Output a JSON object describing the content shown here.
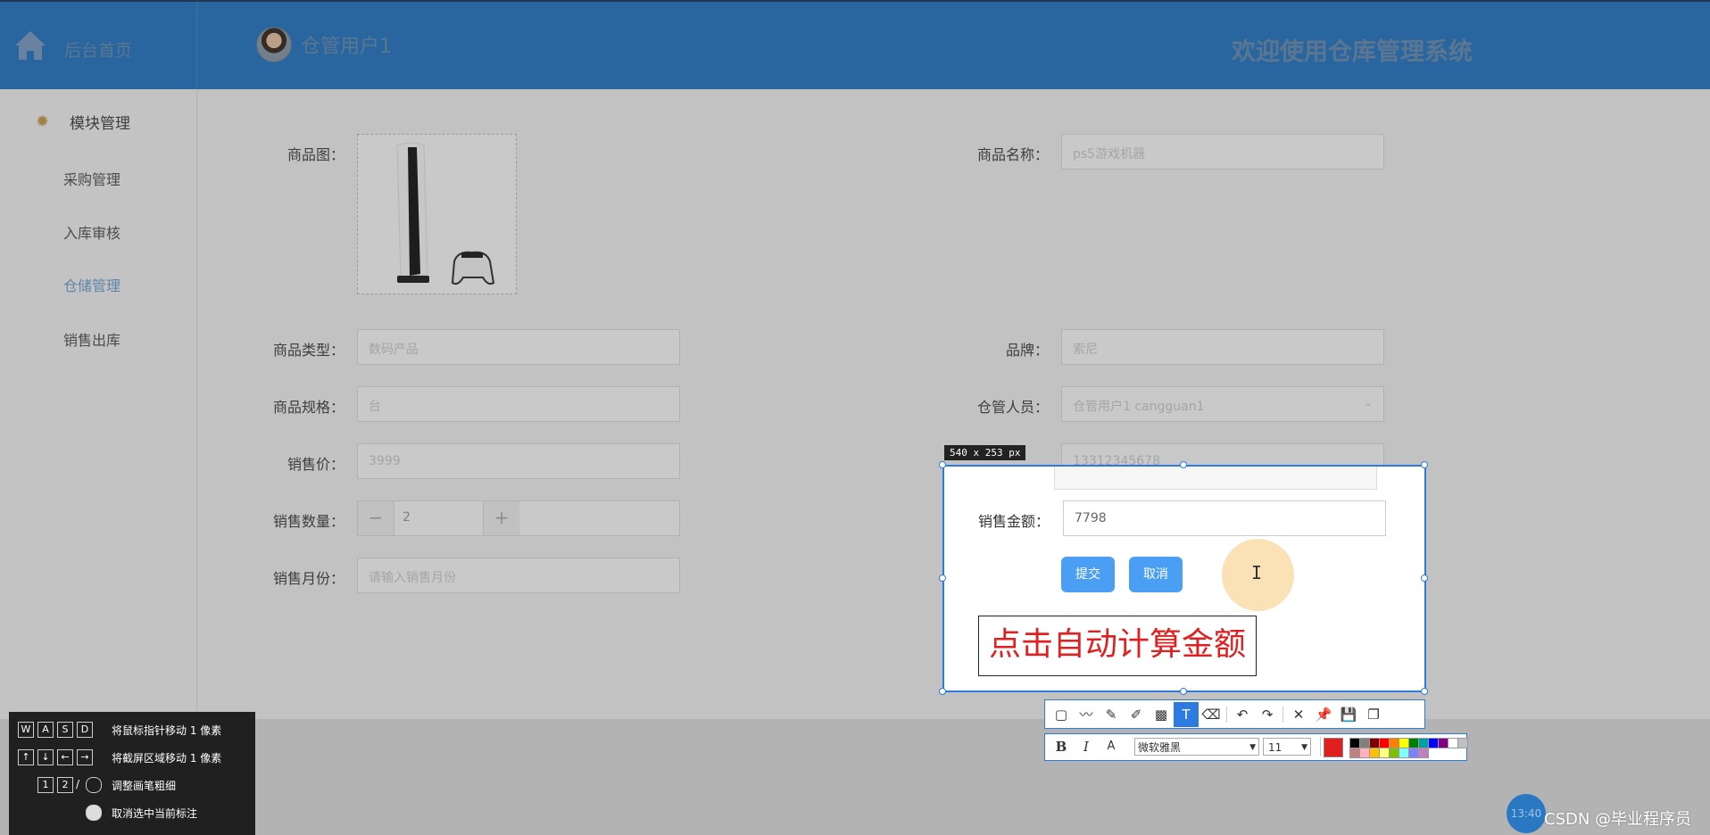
{
  "header": {
    "home_label": "后台首页",
    "user_name": "仓管用户1",
    "welcome": "欢迎使用仓库管理系统"
  },
  "sidebar": {
    "title": "模块管理",
    "items": [
      {
        "label": "采购管理",
        "active": false
      },
      {
        "label": "入库审核",
        "active": false
      },
      {
        "label": "仓储管理",
        "active": true
      },
      {
        "label": "销售出库",
        "active": false
      }
    ]
  },
  "form": {
    "image_label": "商品图：",
    "name_label": "商品名称：",
    "name_value": "ps5游戏机器",
    "type_label": "商品类型：",
    "type_value": "数码产品",
    "brand_label": "品牌：",
    "brand_value": "索尼",
    "spec_label": "商品规格：",
    "spec_value": "台",
    "keeper_label": "仓管人员：",
    "keeper_value": "仓管用户1 cangguan1",
    "price_label": "销售价：",
    "price_value": "3999",
    "phone_value": "13312345678",
    "qty_label": "销售数量：",
    "qty_value": "2",
    "qty_minus": "−",
    "qty_plus": "+",
    "amount_label": "销售金额：",
    "amount_value": "7798",
    "month_label": "销售月份：",
    "month_placeholder": "请输入销售月份",
    "submit_label": "提交",
    "cancel_label": "取消"
  },
  "screenshot_tool": {
    "size_tag": "540 x 253  px",
    "annotation_text": "点击自动计算金额",
    "font_name": "微软雅黑",
    "font_size": "11",
    "tools": [
      "rect-icon",
      "polyline-icon",
      "pen-icon",
      "highlighter-icon",
      "mosaic-icon",
      "text-icon",
      "eraser-icon",
      "undo-icon",
      "redo-icon",
      "close-icon",
      "pin-icon",
      "save-icon",
      "copy-icon"
    ],
    "active_tool": "text-icon",
    "current_color": "#e02020",
    "palette": [
      "#000000",
      "#808080",
      "#800000",
      "#ff0000",
      "#ff8000",
      "#ffff00",
      "#008000",
      "#00a0a0",
      "#0000ff",
      "#800080",
      "#ffffff",
      "#c0c0c0",
      "#c08080",
      "#ffb0c0",
      "#ffc000",
      "#ffff80",
      "#80c000",
      "#80ffff",
      "#8080ff",
      "#c080c0"
    ]
  },
  "hints": [
    {
      "keys": [
        "W",
        "A",
        "S",
        "D"
      ],
      "text": "将鼠标指针移动 1 像素"
    },
    {
      "keys": [
        "↑",
        "↓",
        "←",
        "→"
      ],
      "text": "将截屏区域移动 1 像素"
    },
    {
      "keys": [
        "1",
        "2",
        "/",
        "mouse"
      ],
      "text": "调整画笔粗细"
    },
    {
      "keys": [
        "mouse"
      ],
      "text": "取消选中当前标注"
    }
  ],
  "taskbar": {
    "clock": "13:40",
    "watermark": "CSDN @毕业程序员"
  }
}
